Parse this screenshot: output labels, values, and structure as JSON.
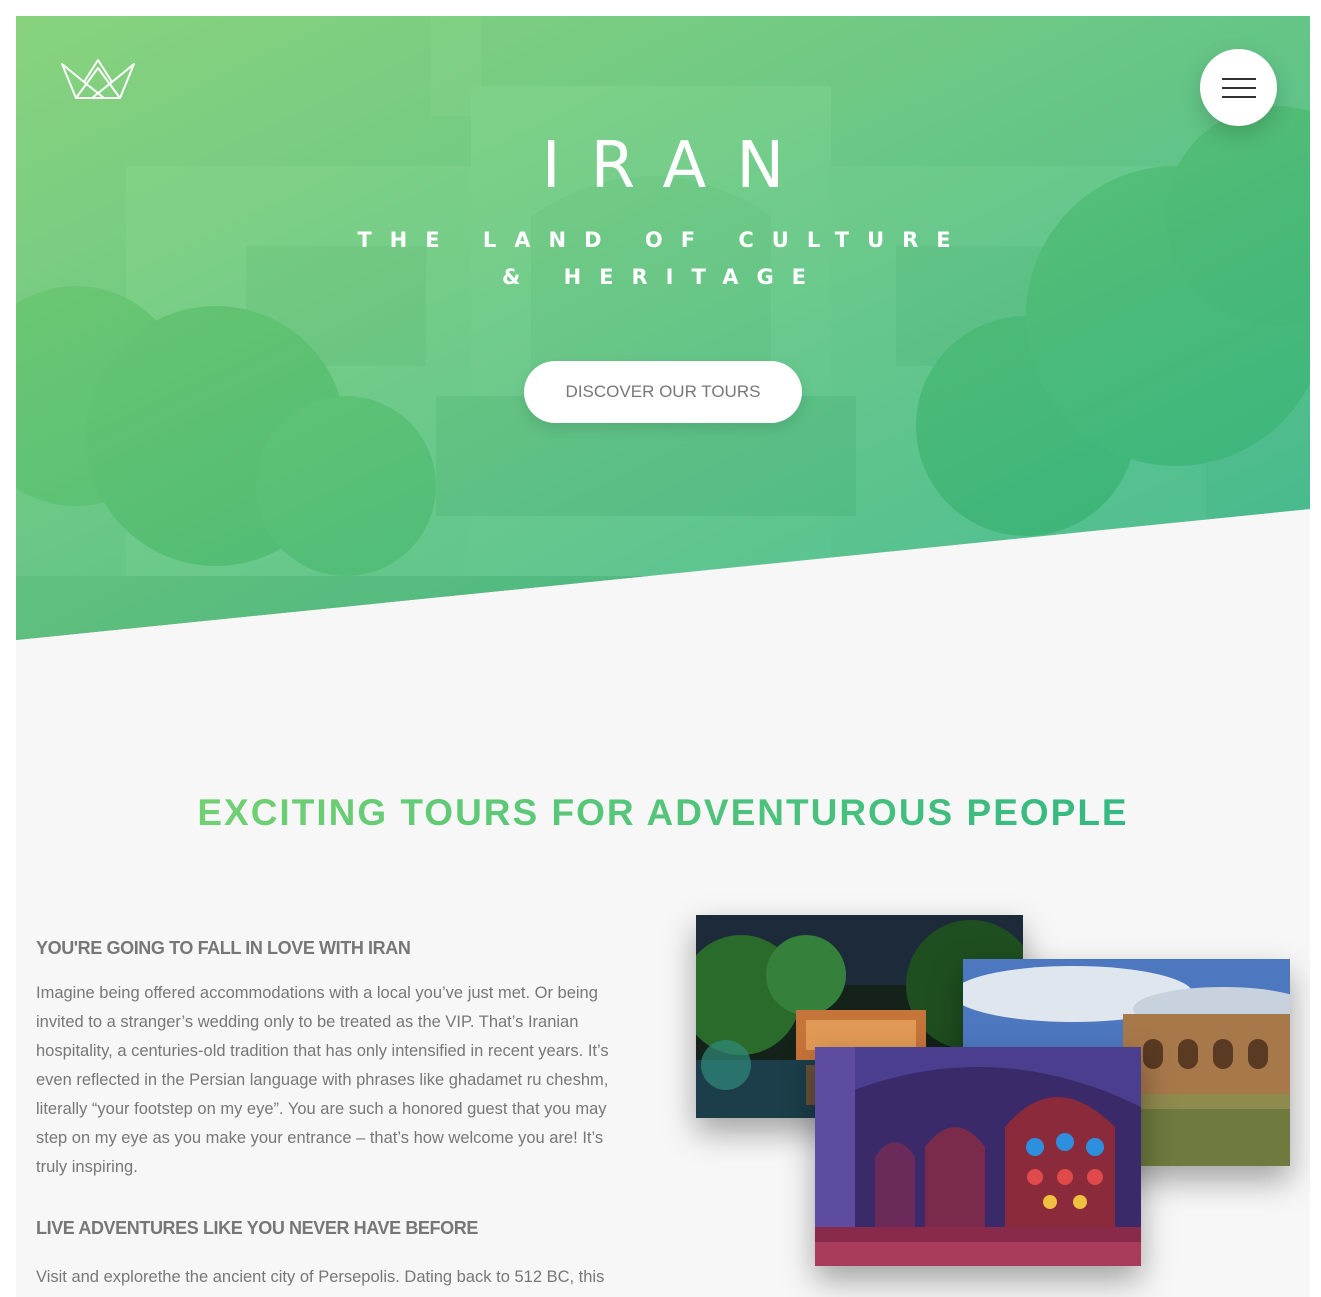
{
  "hero": {
    "title": "IRAN",
    "subtitle": "THE LAND OF CULTURE & HERITAGE",
    "cta_label": "DISCOVER OUR TOURS",
    "gradient": [
      "#7ed56f",
      "#28b485"
    ],
    "background_image": "persian-mansion-courtyard",
    "logo_icon": "crown-icon",
    "menu_icon": "hamburger-menu-icon"
  },
  "about": {
    "title": "EXCITING TOURS FOR ADVENTUROUS PEOPLE",
    "heading_1": "YOU'RE GOING TO FALL IN LOVE WITH IRAN",
    "paragraph_1": "Imagine being offered accommodations with a local you’ve just met. Or being invited to a stranger’s wedding only to be treated as the VIP. That’s Iranian hospitality, a centuries-old tradition that has only intensified in recent years. It’s even reflected in the Persian language with phrases like ghadamet ru cheshm, literally “your footstep on my eye”. You are such a honored guest that you may step on my eye as you make your entrance – that’s how welcome you are! It’s truly inspiring.",
    "heading_2": "LIVE ADVENTURES LIKE YOU NEVER HAVE BEFORE",
    "paragraph_2": "Visit and explorethe the ancient city of Persepolis. Dating back to 512 BC, this",
    "photos": [
      "palace-at-night-photo",
      "stone-arch-bridge-photo",
      "stained-glass-mosque-photo"
    ]
  }
}
